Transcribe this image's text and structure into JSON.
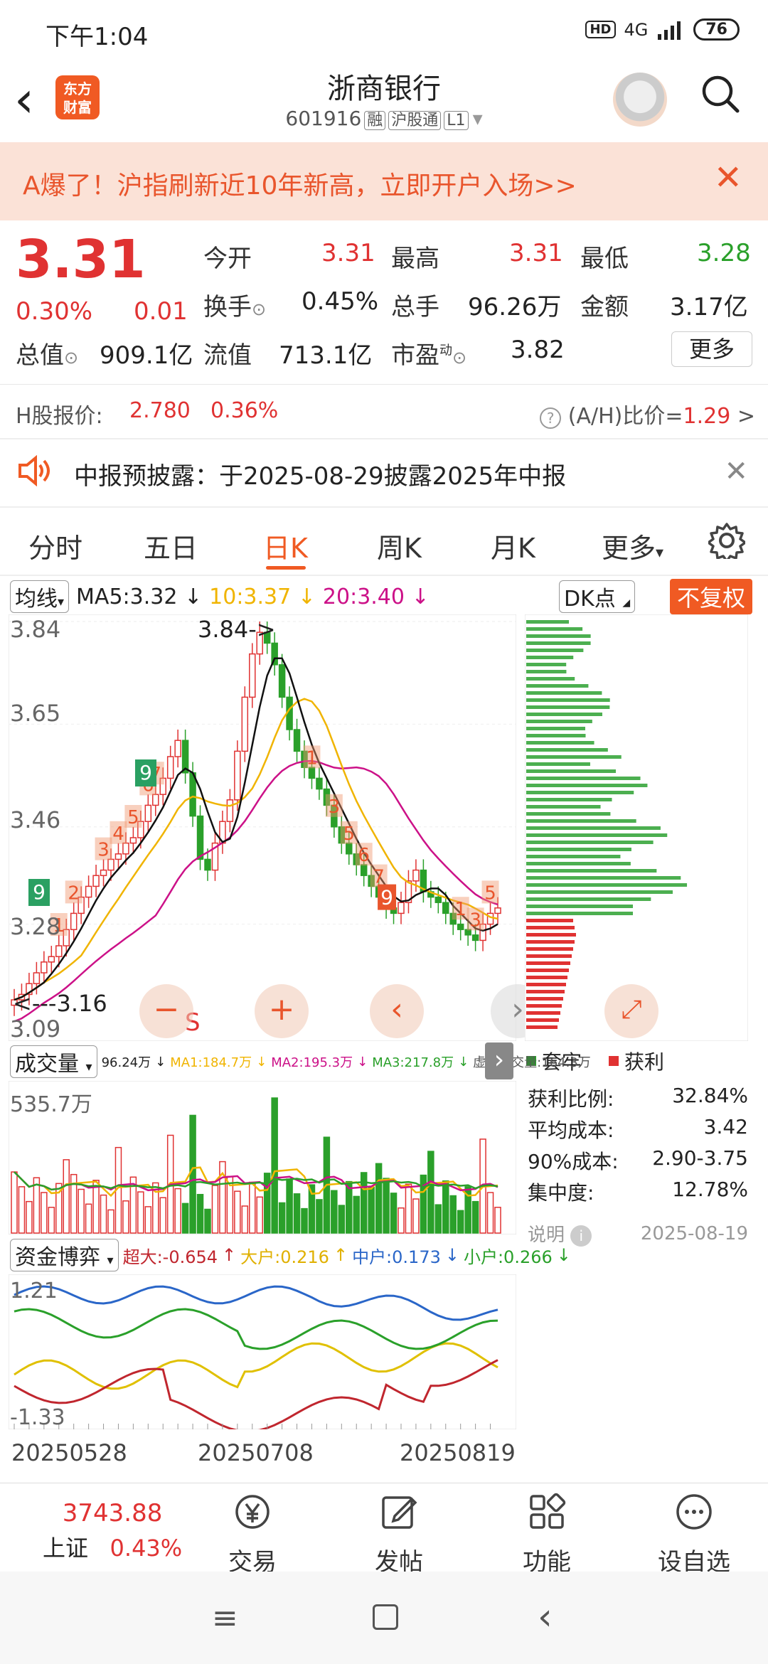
{
  "status_bar": {
    "time": "下午1:04",
    "hd": "HD",
    "network": "4G",
    "battery": "76"
  },
  "header": {
    "logo_line1": "东方",
    "logo_line2": "财富",
    "stock_name": "浙商银行",
    "stock_code": "601916",
    "tag1": "融",
    "tag2": "沪股通",
    "tag3": "L1"
  },
  "banner": {
    "text": "A爆了！沪指刷新近10年新高，立即开户入场>>",
    "close": "✕"
  },
  "quote": {
    "price": "3.31",
    "change_pct": "0.30%",
    "change": "0.01",
    "open_label": "今开",
    "open": "3.31",
    "high_label": "最高",
    "high": "3.31",
    "low_label": "最低",
    "low": "3.28",
    "turnover_label": "换手",
    "turnover": "0.45%",
    "volume_label": "总手",
    "volume": "96.26万",
    "amount_label": "金额",
    "amount": "3.17亿",
    "mktcap_label": "总值",
    "mktcap": "909.1亿",
    "float_label": "流值",
    "float": "713.1亿",
    "pe_label": "市盈",
    "pe_sup": "动",
    "pe": "3.82",
    "more": "更多"
  },
  "hshare": {
    "label": "H股报价:",
    "price": "2.780",
    "pct": "0.36%",
    "ah_label": "(A/H)比价=",
    "ah_value": "1.29",
    "arrow": ">"
  },
  "notice": {
    "text": "中报预披露：于2025-08-29披露2025年中报",
    "close": "✕"
  },
  "tabs": [
    "分时",
    "五日",
    "日K",
    "周K",
    "月K",
    "更多"
  ],
  "ma_bar": {
    "selector": "均线",
    "ma5": "MA5:3.32",
    "ma10": "10:3.37",
    "ma20": "20:3.40",
    "dk": "DK点",
    "fq": "不复权"
  },
  "kline": {
    "axis": [
      "3.84",
      "3.65",
      "3.46",
      "3.28",
      "3.09"
    ],
    "max_note": "3.84->",
    "min_note": "<---3.16",
    "signals": [
      "9",
      "9"
    ],
    "s_mark": "S"
  },
  "vol_bar": {
    "selector": "成交量",
    "v": "96.24万",
    "ma1": "MA1:184.7万",
    "ma2": "MA2:195.3万",
    "ma3": "MA3:217.8万",
    "virtual": "虚拟成交量:164.3万",
    "max": "535.7万"
  },
  "fund_bar": {
    "selector": "资金博弈",
    "super": "超大:-0.654",
    "big": "大户:0.216",
    "mid": "中户:0.173",
    "small": "小户:0.266",
    "top": "1.21",
    "bottom": "-1.33"
  },
  "dates": [
    "20250528",
    "20250708",
    "20250819"
  ],
  "chips": {
    "legend_trap": "套牢",
    "legend_profit": "获利",
    "rows": [
      {
        "label": "获利比例:",
        "value": "32.84%"
      },
      {
        "label": "平均成本:",
        "value": "3.42"
      },
      {
        "label": "90%成本:",
        "value": "2.90-3.75"
      },
      {
        "label": "集中度:",
        "value": "12.78%"
      }
    ],
    "note": "说明",
    "date": "2025-08-19"
  },
  "bottom": {
    "index_value": "3743.88",
    "index_name": "上证",
    "index_pct": "0.43%",
    "items": [
      "交易",
      "发帖",
      "功能",
      "设自选"
    ]
  },
  "colors": {
    "up": "#e03232",
    "down": "#2aa02a",
    "accent": "#f05a23",
    "ma5": "#111111",
    "ma10": "#f0b400",
    "ma20": "#cc1188"
  }
}
